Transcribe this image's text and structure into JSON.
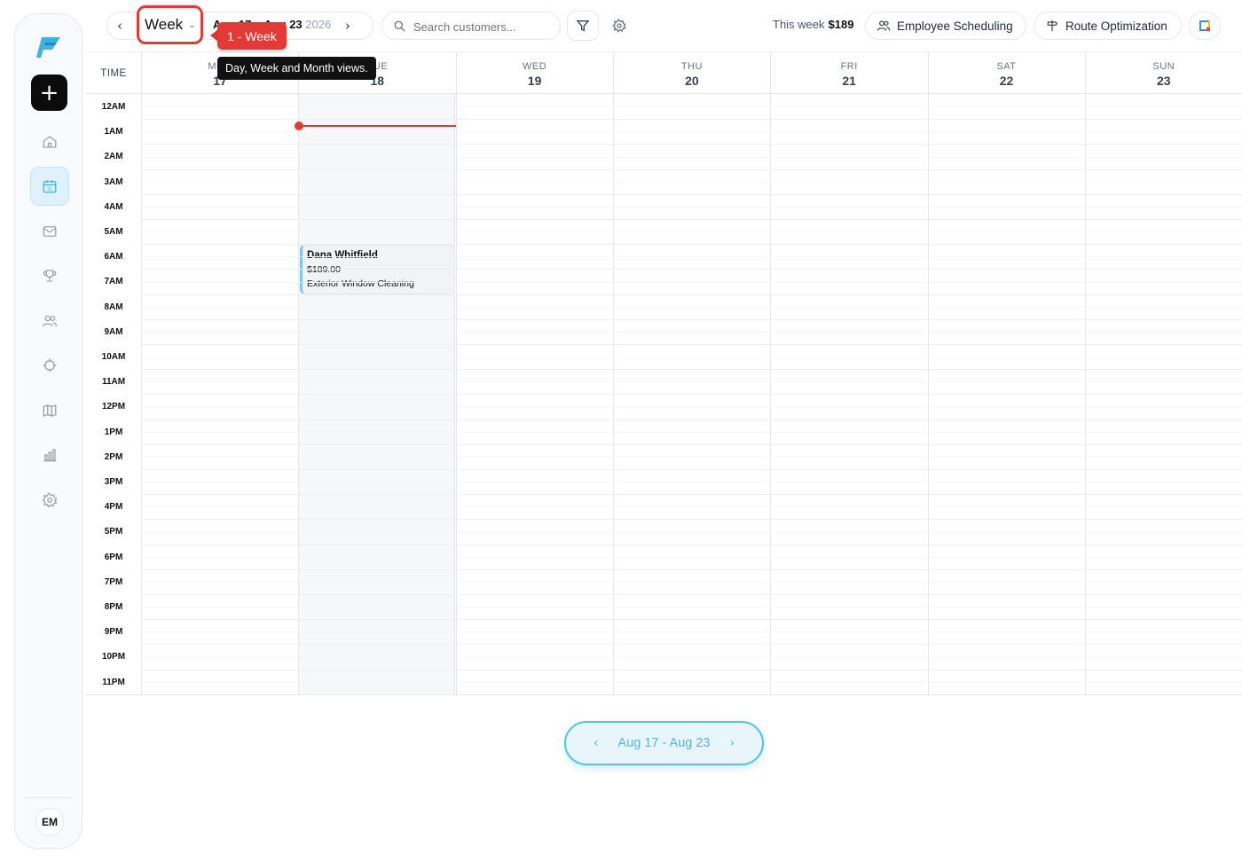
{
  "toolbar": {
    "view_label": "Week",
    "date_range_bold": "Aug 17 – Aug 23",
    "date_year": "2026",
    "search_placeholder": "Search customers...",
    "week_total_label": "This week",
    "week_total_value": "$189",
    "employee_scheduling_label": "Employee Scheduling",
    "route_optimization_label": "Route Optimization"
  },
  "annotation": {
    "callout": "1 - Week",
    "tooltip": "Day, Week and Month views."
  },
  "calendar": {
    "time_header": "TIME",
    "days": [
      {
        "name": "MON",
        "num": "17"
      },
      {
        "name": "TUE",
        "num": "18"
      },
      {
        "name": "WED",
        "num": "19"
      },
      {
        "name": "THU",
        "num": "20"
      },
      {
        "name": "FRI",
        "num": "21"
      },
      {
        "name": "SAT",
        "num": "22"
      },
      {
        "name": "SUN",
        "num": "23"
      }
    ],
    "today_index": 1,
    "hours": [
      "12AM",
      "1AM",
      "2AM",
      "3AM",
      "4AM",
      "5AM",
      "6AM",
      "7AM",
      "8AM",
      "9AM",
      "10AM",
      "11AM",
      "12PM",
      "1PM",
      "2PM",
      "3PM",
      "4PM",
      "5PM",
      "6PM",
      "7PM",
      "8PM",
      "9PM",
      "10PM",
      "11PM"
    ],
    "event": {
      "customer": "Dana Whitfield",
      "price": "$189.00",
      "service": "Exterior Window Cleaning"
    }
  },
  "footer": {
    "range_label": "Aug 17 - Aug 23"
  },
  "user": {
    "initials": "EM"
  },
  "icons": {
    "sidebar": [
      "home-icon",
      "calendar-icon",
      "mail-icon",
      "trophy-icon",
      "users-icon",
      "crosshair-icon",
      "map-icon",
      "bar-chart-icon",
      "gear-icon"
    ]
  },
  "colors": {
    "accent": "#4fc3e8",
    "annotation_red": "#e53935",
    "active_nav_bg": "#dff2fb"
  }
}
